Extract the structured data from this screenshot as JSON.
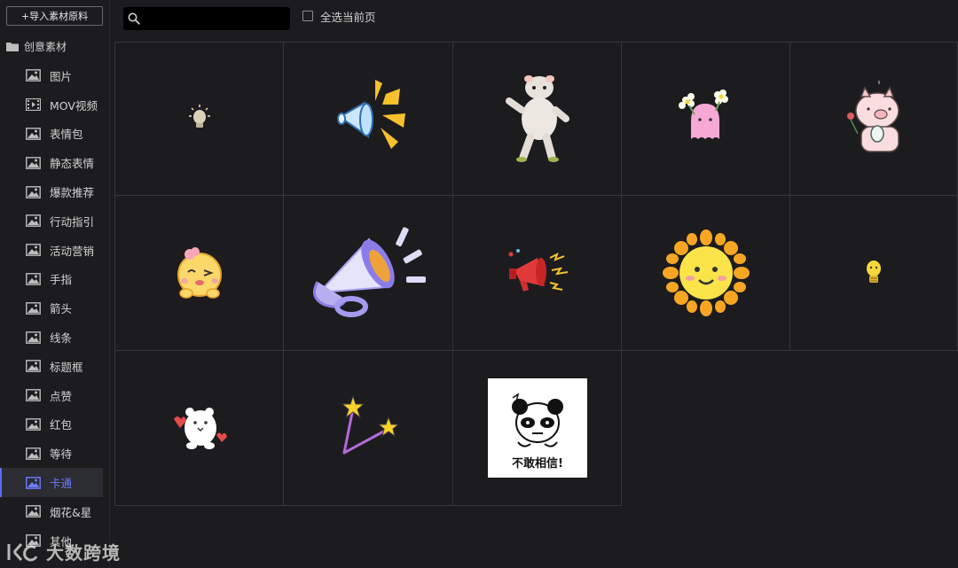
{
  "sidebar": {
    "import_label": "+导入素材原料",
    "category_label": "创意素材",
    "items": [
      {
        "label": "图片",
        "icon": "image-icon"
      },
      {
        "label": "MOV视频",
        "icon": "video-icon"
      },
      {
        "label": "表情包",
        "icon": "image-icon"
      },
      {
        "label": "静态表情",
        "icon": "image-icon"
      },
      {
        "label": "爆款推荐",
        "icon": "image-icon"
      },
      {
        "label": "行动指引",
        "icon": "image-icon"
      },
      {
        "label": "活动营销",
        "icon": "image-icon"
      },
      {
        "label": "手指",
        "icon": "image-icon"
      },
      {
        "label": "箭头",
        "icon": "image-icon"
      },
      {
        "label": "线条",
        "icon": "image-icon"
      },
      {
        "label": "标题框",
        "icon": "image-icon"
      },
      {
        "label": "点赞",
        "icon": "image-icon"
      },
      {
        "label": "红包",
        "icon": "image-icon"
      },
      {
        "label": "等待",
        "icon": "image-icon"
      },
      {
        "label": "卡通",
        "icon": "image-icon"
      },
      {
        "label": "烟花&星",
        "icon": "image-icon"
      },
      {
        "label": "其他",
        "icon": "image-icon"
      }
    ],
    "active_item": "卡通"
  },
  "toolbar": {
    "search_value": "",
    "search_icon": "search-icon",
    "select_all_label": "全选当前页",
    "select_all_checked": false
  },
  "stickers": [
    {
      "name": "lightbulb-sticker"
    },
    {
      "name": "megaphone-sticker"
    },
    {
      "name": "dancing-hamster-sticker"
    },
    {
      "name": "pink-ghost-flowers-sticker"
    },
    {
      "name": "pig-sticker"
    },
    {
      "name": "wink-face-sticker"
    },
    {
      "name": "purple-megaphone-sticker"
    },
    {
      "name": "red-megaphone-sticker"
    },
    {
      "name": "sun-sticker"
    },
    {
      "name": "small-lightbulb-sticker"
    },
    {
      "name": "white-bear-sticker"
    },
    {
      "name": "star-wand-sticker"
    },
    {
      "name": "panda-meme-sticker",
      "caption": "不敢相信!"
    }
  ],
  "watermark": {
    "text": "大数跨境"
  },
  "colors": {
    "accent": "#5b6cff",
    "background": "#1c1c1f",
    "grid_border": "#353538"
  }
}
